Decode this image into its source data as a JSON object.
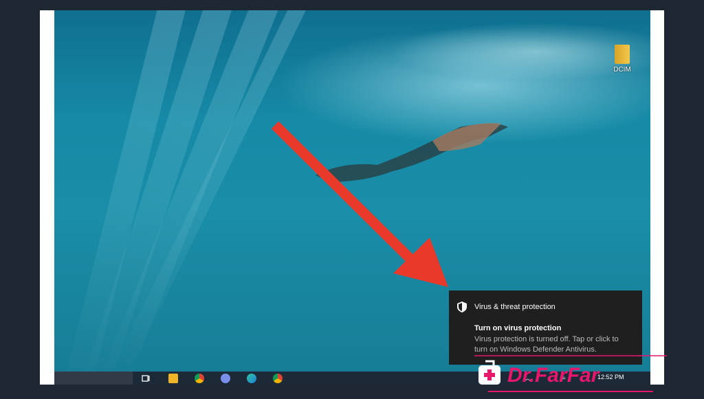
{
  "desktop": {
    "icons": [
      {
        "label": "DCIM",
        "icon": "folder-icon"
      }
    ]
  },
  "notification": {
    "title": "Virus & threat protection",
    "heading": "Turn on virus protection",
    "body": "Virus protection is turned off. Tap or click to turn on Windows Defender Antivirus.",
    "icon": "shield-icon"
  },
  "taskbar": {
    "apps": [
      "task-view-icon",
      "file-explorer-icon",
      "chrome-icon",
      "app-icon",
      "edge-icon",
      "chrome-icon"
    ],
    "tray": {
      "time": "12:52 PM"
    }
  },
  "watermark": {
    "text": "Dr.FarFar"
  },
  "colors": {
    "accent_arrow": "#e8392a",
    "toast_bg": "#1f1f1f",
    "watermark_pink": "#e8176b"
  }
}
